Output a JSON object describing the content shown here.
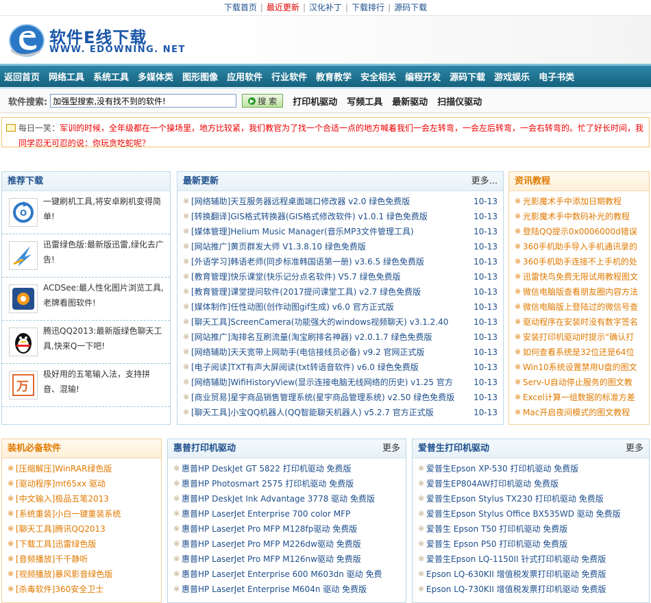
{
  "topnav": [
    {
      "label": "下载首页",
      "color": "#1d4e8c"
    },
    {
      "label": "最近更新",
      "color": "#e00000"
    },
    {
      "label": "汉化补丁",
      "color": "#1d4e8c"
    },
    {
      "label": "下载排行",
      "color": "#1d4e8c"
    },
    {
      "label": "源码下载",
      "color": "#1d4e8c"
    }
  ],
  "logo": {
    "cn": "软件E线下载",
    "en": "WWW. EDOWNING. NET"
  },
  "nav": [
    "返回首页",
    "网络工具",
    "系统工具",
    "多媒体类",
    "图形图像",
    "应用软件",
    "行业软件",
    "教育教学",
    "安全相关",
    "编程开发",
    "源码下载",
    "游戏娱乐",
    "电子书类"
  ],
  "search": {
    "label": "软件搜索:",
    "value": "加强型搜索,没有找不到的软件!",
    "button": "搜 索",
    "hotlinks": [
      "打印机驱动",
      "写频工具",
      "最新驱动",
      "扫描仪驱动"
    ]
  },
  "notice": {
    "label": "每日一笑：",
    "text": "军训的时候，全年级都在一个操场里，地方比较紧，我们教官为了找一个合适一点的地方喊着我们一会左转弯，一会左后转弯，一会右转弯的。忙了好长时间，我同学忍无可忍的说：你玩贪吃蛇呢？"
  },
  "recommend": {
    "title": "推荐下载",
    "items": [
      {
        "text": "一键刷机工具,将安卓刷机变得简单!",
        "icon": "flash-tool-icon"
      },
      {
        "text": "迅雷绿色版:最新版迅雷,绿化去广告!",
        "icon": "thunder-icon"
      },
      {
        "text": "ACDSee:最人性化图片浏览工具,老牌看图软件!",
        "icon": "acdsee-icon"
      },
      {
        "text": "腾迅QQ2013:最新版绿色聊天工具,快来Q一下吧!",
        "icon": "qq-penguin-icon"
      },
      {
        "text": "极好用的五笔输入法，支持拼音、混输!",
        "icon": "wubi-input-icon"
      }
    ]
  },
  "latest": {
    "title": "最新更新",
    "more": "更多...",
    "items": [
      {
        "cat": "[网络辅助]",
        "name": "天互服务器远程桌面端口修改器 v2.0 绿色免费版",
        "date": "10-13"
      },
      {
        "cat": "[转换翻译]",
        "name": "GIS格式转换器(GIS格式修改软件) v1.0.1 绿色免费版",
        "date": "10-13"
      },
      {
        "cat": "[媒体管理]",
        "name": "Helium Music Manager(音乐MP3文件管理工具)",
        "date": "10-13"
      },
      {
        "cat": "[网站推广]",
        "name": "黄页群发大师 V1.3.8.10 绿色免费版",
        "date": "10-13"
      },
      {
        "cat": "[外语学习]",
        "name": "韩语老师(同步标准韩国语第一册) v3.6.5 绿色免费版",
        "date": "10-13"
      },
      {
        "cat": "[教育管理]",
        "name": "快乐课堂(快乐记分点名软件) V5.7 绿色免费版",
        "date": "10-13"
      },
      {
        "cat": "[教育管理]",
        "name": "课堂提问软件(2017提问课堂工具) v2.7 绿色免费版",
        "date": "10-13"
      },
      {
        "cat": "[媒体制作]",
        "name": "任性动图(创作动图gif生成) v6.0 官方正式版",
        "date": "10-13"
      },
      {
        "cat": "[聊天工具]",
        "name": "ScreenCamera(功能强大的windows视频聊天) v3.1.2.40",
        "date": "10-13"
      },
      {
        "cat": "[网站推广]",
        "name": "淘排名互刷流量(淘宝刷排名神器) v2.0.1.7 绿色免费版",
        "date": "10-13"
      },
      {
        "cat": "[网络辅助]",
        "name": "天天宽带上网助手(电信接线员必备) v9.2 官网正式版",
        "date": "10-13"
      },
      {
        "cat": "[电子阅读]",
        "name": "TXT有声大屏阅读(txt转语音软件) v6.0 绿色免费版",
        "date": "10-13"
      },
      {
        "cat": "[网络辅助]",
        "name": "WifiHistoryView(显示连接电脑无线网络的历史) v1.25 官方",
        "date": "10-13"
      },
      {
        "cat": "[商业贸易]",
        "name": "星宇商品销售管理系统(星宇商品管理系统) v2.50 绿色免费版",
        "date": "10-13"
      },
      {
        "cat": "[聊天工具]",
        "name": "小宝QQ机器人(QQ智能聊天机器人) v5.2.7 官方正式版",
        "date": "10-13"
      }
    ]
  },
  "tutorials": {
    "title": "资讯教程",
    "items": [
      "光影魔术手中添加日期教程",
      "光影魔术手中数码补光的教程",
      "登陆QQ提示0x0006000d错误",
      "360手机助手导入手机通讯录的",
      "360手机助手连接不上手机的处",
      "迅雷快鸟免费无限试用教程图文",
      "微信电脑版查看朋友圈内容方法",
      "微信电脑版上登陆过的微信号查",
      "驱动程序在安装时没有数字签名",
      "安装打印机驱动时提示“确认打",
      "如何查看系统是32位还是64位",
      "Win10系统设置禁用U盘的图文",
      "Serv-U自动停止服务的图文教",
      "Excel计算一组数据的标准方差",
      "Mac开启夜间模式的图文教程"
    ]
  },
  "essential": {
    "title": "装机必备软件",
    "items": [
      {
        "cat": "[压缩解压]",
        "name": "WinRAR绿色版"
      },
      {
        "cat": "[驱动程序]",
        "name": "mt65xx 驱动"
      },
      {
        "cat": "[中文输入]",
        "name": "极品五笔2013"
      },
      {
        "cat": "[系统重装]",
        "name": "小白一键重装系统"
      },
      {
        "cat": "[聊天工具]",
        "name": "腾讯QQ2013"
      },
      {
        "cat": "[下载工具]",
        "name": "迅雷绿色版"
      },
      {
        "cat": "[音频播放]",
        "name": "千千静听"
      },
      {
        "cat": "[视频播放]",
        "name": "暴风影音绿色版"
      },
      {
        "cat": "[杀毒软件]",
        "name": "360安全卫士"
      }
    ]
  },
  "hp": {
    "title": "惠普打印机驱动",
    "more": "更多",
    "items": [
      "惠普HP DeskJet GT 5822 打印机驱动 免费版",
      "惠普HP Photosmart 2575 打印机驱动 免费版",
      "惠普HP DeskJet Ink Advantage 3778 驱动 免费版",
      "惠普HP LaserJet Enterprise 700 color MFP",
      "惠普HP LaserJet Pro MFP M128fp驱动 免费版",
      "惠普HP LaserJet Pro MFP M226dw驱动 免费版",
      "惠普HP LaserJet Pro MFP M126nw驱动 免费版",
      "惠普HP LaserJet Enterprise 600 M603dn 驱动 免费",
      "惠普HP LaserJet Enterprise M604n 驱动 免费版"
    ]
  },
  "epson": {
    "title": "爱普生打印机驱动",
    "more": "更多",
    "items": [
      "爱普生Epson XP-530 打印机驱动 免费版",
      "爱普生EP804AW打印机驱动 免费版",
      "爱普生Epson Stylus TX230 打印机驱动 免费版",
      "爱普生Epson Stylus Office BX535WD 驱动 免费版",
      "爱普生 Epson T50 打印机驱动 免费版",
      "爱普生 Epson P50 打印机驱动 免费版",
      "爱普生Epson LQ-1150II 针式打印机驱动 免费版",
      "Epson LQ-630KII 增值税发票打印机驱动 免费版",
      "Epson LQ-730KII 增值税发票打印机驱动 免费版"
    ]
  }
}
